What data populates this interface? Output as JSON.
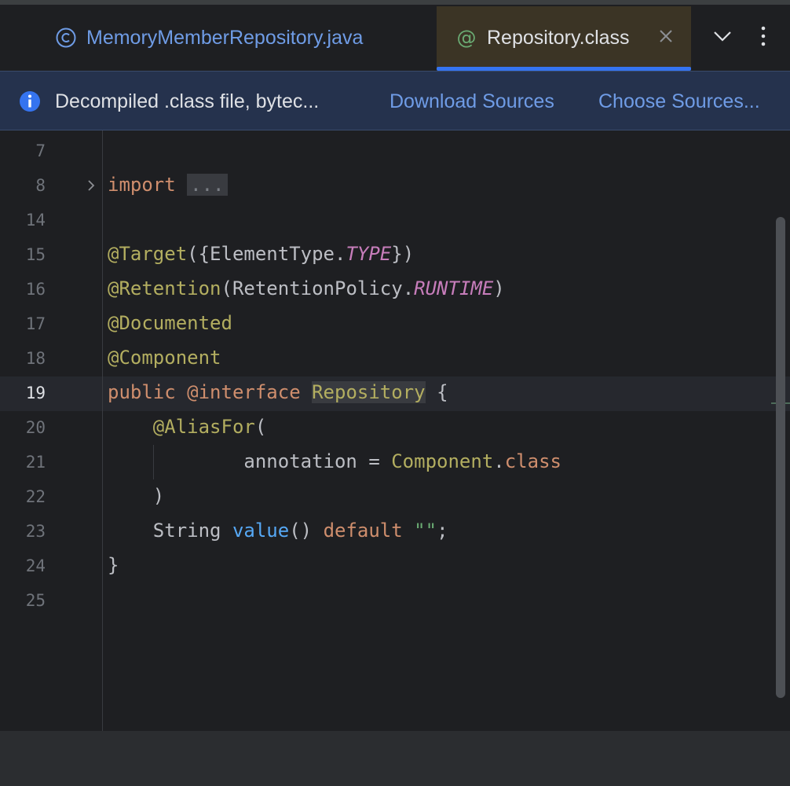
{
  "tabs": [
    {
      "label": "MemoryMemberRepository.java",
      "icon": "class-icon",
      "active": false
    },
    {
      "label": "Repository.class",
      "icon": "annotation-icon",
      "active": true
    }
  ],
  "notification": {
    "text": "Decompiled .class file, bytec...",
    "download_sources": "Download Sources",
    "choose_sources": "Choose Sources..."
  },
  "editor": {
    "line_numbers": [
      "7",
      "8",
      "14",
      "15",
      "16",
      "17",
      "18",
      "19",
      "20",
      "21",
      "22",
      "23",
      "24",
      "25"
    ],
    "current_line": "19",
    "lines": {
      "l8_import": "import",
      "l8_fold": "...",
      "l15_ann": "@Target",
      "l15_a": "({ElementType.",
      "l15_const": "TYPE",
      "l15_b": "})",
      "l16_ann": "@Retention",
      "l16_a": "(RetentionPolicy.",
      "l16_const": "RUNTIME",
      "l16_b": ")",
      "l17_ann": "@Documented",
      "l18_ann": "@Component",
      "l19_public": "public",
      "l19_iface": "@interface",
      "l19_name": "Repository",
      "l19_brace": "{",
      "l20_ann": "@AliasFor",
      "l20_paren": "(",
      "l21_attr": "annotation =",
      "l21_cls": "Component",
      "l21_dot": ".",
      "l21_kw": "class",
      "l22_paren": ")",
      "l23_type": "String",
      "l23_fn": "value",
      "l23_parens": "()",
      "l23_default": "default",
      "l23_str": "\"\"",
      "l23_semi": ";",
      "l24_brace": "}"
    }
  }
}
